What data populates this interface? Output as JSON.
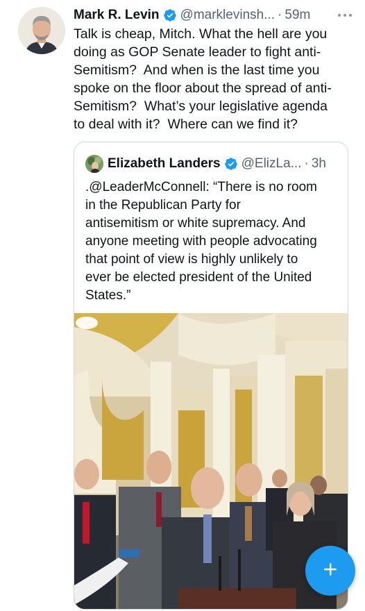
{
  "tweet": {
    "author_name": "Mark R. Levin",
    "handle": "@marklevinsh...",
    "separator": "·",
    "time": "59m",
    "more_icon": "ellipsis-icon",
    "text": "Talk is cheap, Mitch. What the hell are you\ndoing as GOP Senate leader to fight anti-\nSemitism?  And when is the last time you\nspoke on the floor about the spread of anti-\nSemitism?  What’s your legislative agenda\nto deal with it?  Where can we find it?"
  },
  "quoted_tweet": {
    "author_name": "Elizabeth Landers",
    "handle": "@ElizLa...",
    "separator": "·",
    "time": "3h",
    "text": ".@LeaderMcConnell: “There is no room\nin the Republican Party for\nantisemitism or white supremacy. And\nanyone meeting with people advocating\nthat point of view is highly unlikely to\never be elected president of the United\nStates.”"
  },
  "compose_button": {
    "icon": "plus-icon"
  },
  "colors": {
    "accent": "#1d9bf0",
    "text_primary": "#0f1419",
    "text_secondary": "#536471",
    "border": "#cfd9de"
  }
}
